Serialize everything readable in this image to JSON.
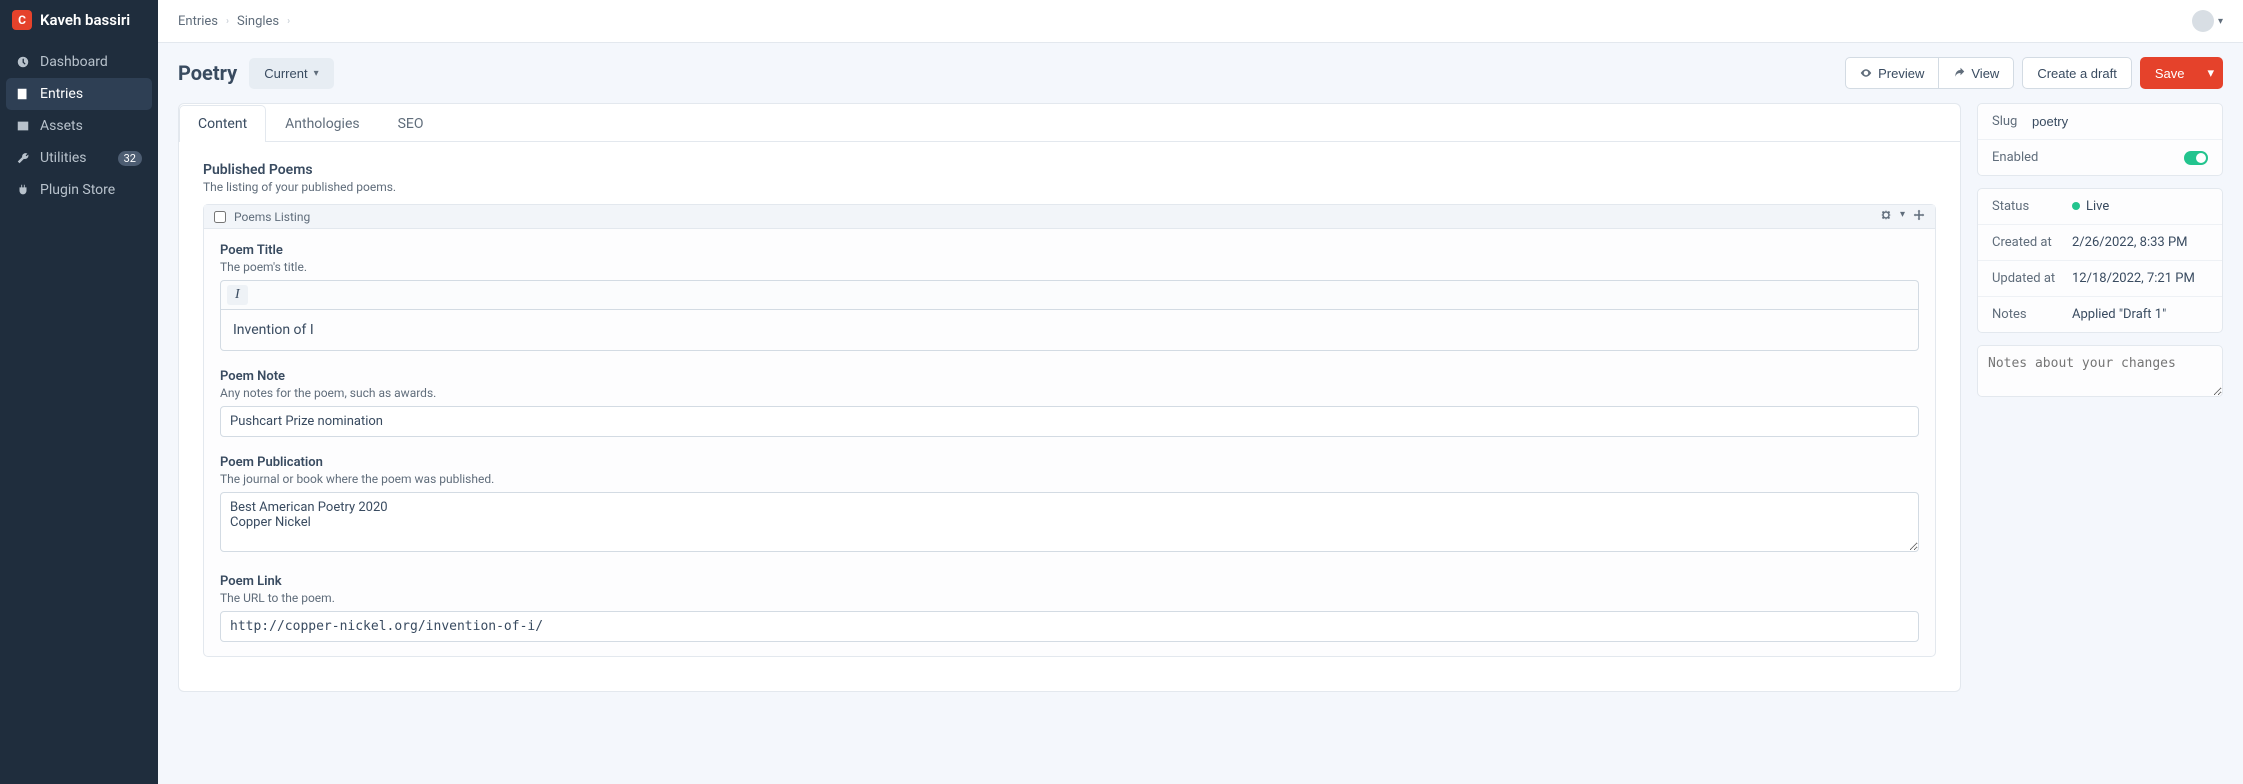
{
  "site": {
    "logo_letter": "C",
    "name": "Kaveh bassiri"
  },
  "nav": {
    "dashboard": "Dashboard",
    "entries": "Entries",
    "assets": "Assets",
    "utilities": "Utilities",
    "utilities_badge": "32",
    "plugin_store": "Plugin Store"
  },
  "breadcrumb": {
    "entries": "Entries",
    "singles": "Singles"
  },
  "page": {
    "title": "Poetry",
    "revision_label": "Current"
  },
  "actions": {
    "preview": "Preview",
    "view": "View",
    "create_draft": "Create a draft",
    "save": "Save"
  },
  "tabs": {
    "content": "Content",
    "anthologies": "Anthologies",
    "seo": "SEO"
  },
  "section": {
    "title": "Published Poems",
    "desc": "The listing of your published poems."
  },
  "block": {
    "name": "Poems Listing"
  },
  "fields": {
    "title": {
      "label": "Poem Title",
      "desc": "The poem's title.",
      "toolbar_italic": "I",
      "value": "Invention of I"
    },
    "note": {
      "label": "Poem Note",
      "desc": "Any notes for the poem, such as awards.",
      "value": "Pushcart Prize nomination"
    },
    "publication": {
      "label": "Poem Publication",
      "desc": "The journal or book where the poem was published.",
      "value": "Best American Poetry 2020\nCopper Nickel"
    },
    "link": {
      "label": "Poem Link",
      "desc": "The URL to the poem.",
      "value": "http://copper-nickel.org/invention-of-i/"
    }
  },
  "meta": {
    "slug_label": "Slug",
    "slug_value": "poetry",
    "enabled_label": "Enabled",
    "status_label": "Status",
    "status_value": "Live",
    "created_label": "Created at",
    "created_value": "2/26/2022, 8:33 PM",
    "updated_label": "Updated at",
    "updated_value": "12/18/2022, 7:21 PM",
    "notes_label": "Notes",
    "notes_value": "Applied \"Draft 1\"",
    "changes_placeholder": "Notes about your changes"
  }
}
